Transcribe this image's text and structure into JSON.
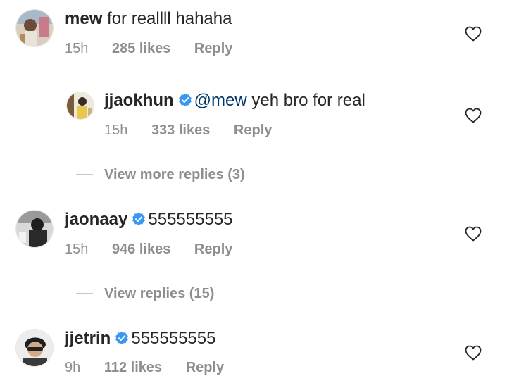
{
  "colors": {
    "text": "#262626",
    "muted": "#8e8e8e",
    "mention": "#00376b",
    "verified": "#3897f0"
  },
  "comments": [
    {
      "username": "mew",
      "verified": false,
      "mention": "",
      "text": "for reallll hahaha",
      "time": "15h",
      "likes": "285 likes",
      "reply": "Reply",
      "like_icon": "heart-icon"
    },
    {
      "username": "jjaokhun",
      "verified": true,
      "mention": "@mew",
      "text": "yeh bro for real",
      "time": "15h",
      "likes": "333 likes",
      "reply": "Reply",
      "like_icon": "heart-icon"
    },
    {
      "username": "jaonaay",
      "verified": true,
      "mention": "",
      "text": "555555555",
      "time": "15h",
      "likes": "946 likes",
      "reply": "Reply",
      "like_icon": "heart-icon"
    },
    {
      "username": "jjetrin",
      "verified": true,
      "mention": "",
      "text": "555555555",
      "time": "9h",
      "likes": "112 likes",
      "reply": "Reply",
      "like_icon": "heart-icon"
    }
  ],
  "view_more_replies": "View more replies (3)",
  "view_replies": "View replies (15)"
}
